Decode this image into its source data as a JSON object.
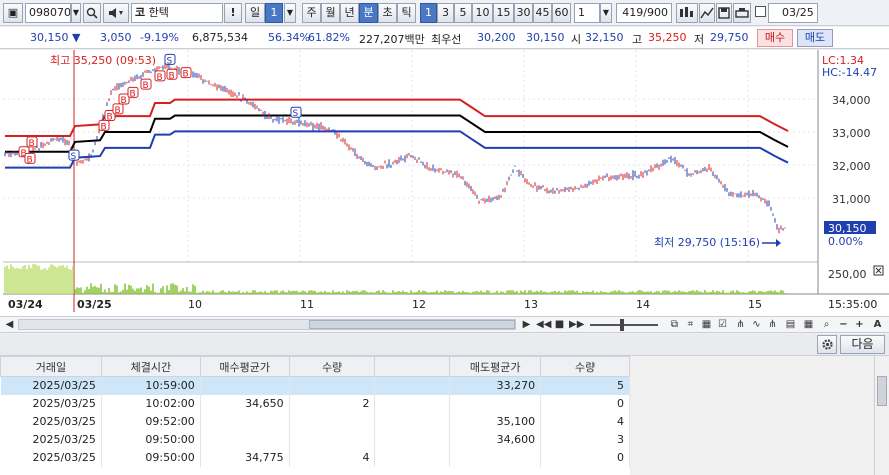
{
  "toolbar": {
    "stock_code": "098070",
    "search_icon": "search-icon",
    "sound_icon": "speaker-icon",
    "market_prefix": "코",
    "stock_name": "한텍",
    "exclaim_label": "!",
    "period_day": "일",
    "period_count": "1",
    "period_week": "주",
    "period_month": "월",
    "period_year": "년",
    "period_minute": "분",
    "period_second": "초",
    "period_tick": "틱",
    "intervals": [
      "1",
      "3",
      "5",
      "10",
      "15",
      "30",
      "45",
      "60"
    ],
    "interval_select": "1",
    "count_display": "419/900",
    "date_value": "03/25"
  },
  "quote": {
    "price": "30,150",
    "change": "3,050",
    "change_pct": "-9.19%",
    "volume": "6,875,534",
    "ratio1": "56.34%",
    "ratio2": "61.82%",
    "amount": "227,207백만",
    "best_bid_label": "최우선",
    "best_ask": "30,200",
    "best_bid": "30,150",
    "open_label": "시",
    "open": "32,150",
    "high_label": "고",
    "high": "35,250",
    "low_label": "저",
    "low": "29,750",
    "buy_button": "매수",
    "sell_button": "매도",
    "colors": {
      "up": "#d62020",
      "down": "#1f3fb0"
    }
  },
  "chart": {
    "high_annotation": "최고 35,250 (09:53)",
    "low_annotation": "최저 29,750 (15:16)",
    "lc_label": "LC:1.34",
    "hc_label": "HC:-14.47",
    "price_ticks": [
      "34,000",
      "33,000",
      "32,000",
      "31,000"
    ],
    "current_price_box": "30,150",
    "current_pct": "0.00%",
    "volume_tick": "250,00",
    "x_labels": [
      "03/24",
      "03/25",
      "10",
      "11",
      "12",
      "13",
      "14",
      "15"
    ],
    "time_label": "15:35:00",
    "buy_marker": "B",
    "sell_marker": "S",
    "colors": {
      "candle_up": "#d62020",
      "candle_down": "#1f3fb0",
      "envelope_upper": "#d62020",
      "envelope_mid": "#000000",
      "envelope_lower": "#1f3fb0",
      "volume": "#8cc63f"
    }
  },
  "table": {
    "headers": [
      "거래일",
      "체결시간",
      "매수평균가",
      "수량",
      "",
      "매도평균가",
      "수량"
    ],
    "rows": [
      [
        "2025/03/25",
        "10:59:00",
        "",
        "",
        "",
        "33,270",
        "5"
      ],
      [
        "2025/03/25",
        "10:02:00",
        "34,650",
        "2",
        "",
        "",
        "0"
      ],
      [
        "2025/03/25",
        "09:52:00",
        "",
        "",
        "",
        "35,100",
        "4"
      ],
      [
        "2025/03/25",
        "09:50:00",
        "",
        "",
        "",
        "34,600",
        "3"
      ],
      [
        "2025/03/25",
        "09:50:00",
        "34,775",
        "4",
        "",
        "",
        "0"
      ]
    ]
  },
  "panel": {
    "settings_icon": "gear-icon",
    "next_button": "다음"
  }
}
